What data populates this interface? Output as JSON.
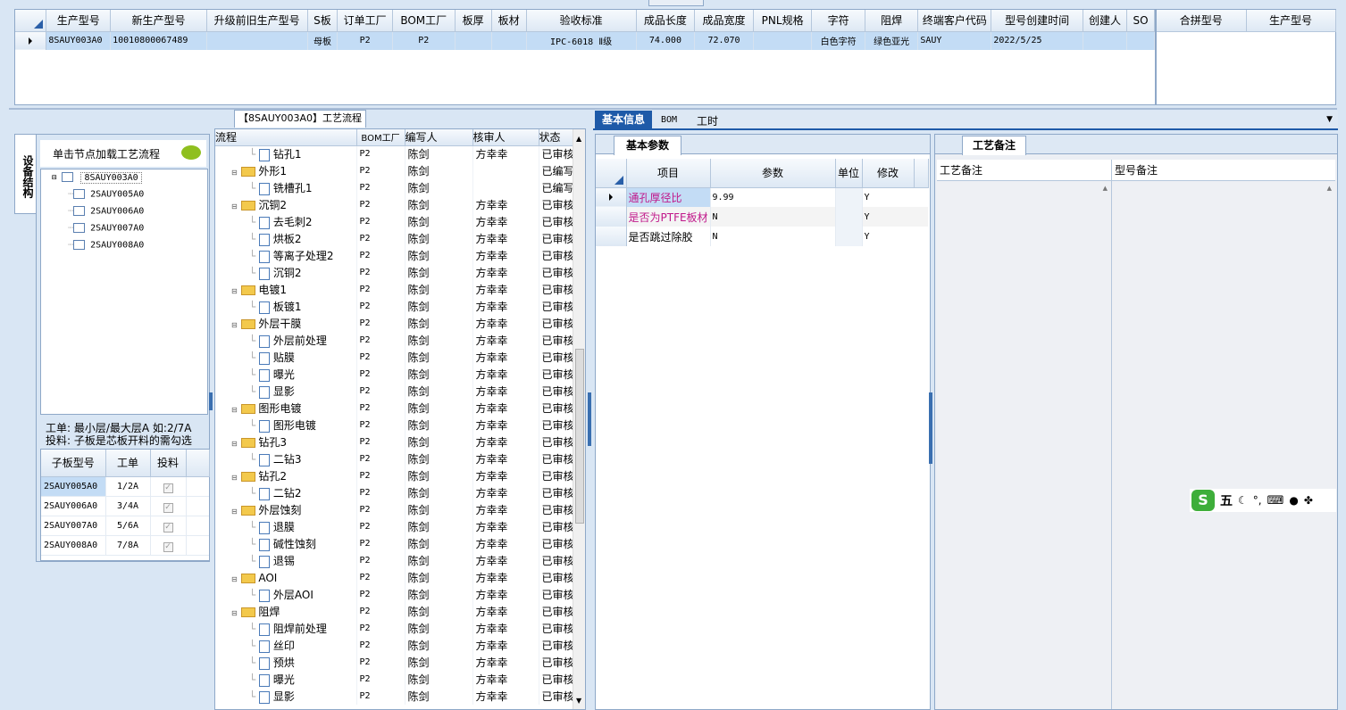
{
  "top_grid": {
    "columns": [
      "生产型号",
      "新生产型号",
      "升级前旧生产型号",
      "S板",
      "订单工厂",
      "BOM工厂",
      "板厚",
      "板材",
      "验收标准",
      "成品长度",
      "成品宽度",
      "PNL规格",
      "字符",
      "阻焊",
      "终端客户代码",
      "型号创建时间",
      "创建人",
      "SO"
    ],
    "row": [
      "8SAUY003A0",
      "10010800067489",
      "",
      "母板",
      "P2",
      "P2",
      "",
      "",
      "IPC-6018 Ⅱ级",
      "74.000",
      "72.070",
      "",
      "白色字符",
      "绿色亚光",
      "SAUY",
      "2022/5/25",
      "",
      ""
    ]
  },
  "merge_grid": {
    "columns": [
      "合拼型号",
      "生产型号"
    ]
  },
  "left_panel": {
    "side_tab": "设备结构",
    "hint": "单击节点加载工艺流程",
    "tree_root": "8SAUY003A0",
    "tree_children": [
      "2SAUY005A0",
      "2SAUY006A0",
      "2SAUY007A0",
      "2SAUY008A0"
    ],
    "note_line1": "工单: 最小层/最大层A 如:2/7A",
    "note_line2": "投料: 子板是芯板开料的需勾选",
    "sub_columns": [
      "子板型号",
      "工单",
      "投料"
    ],
    "sub_rows": [
      {
        "model": "2SAUY005A0",
        "order": "1/2A"
      },
      {
        "model": "2SAUY006A0",
        "order": "3/4A"
      },
      {
        "model": "2SAUY007A0",
        "order": "5/6A"
      },
      {
        "model": "2SAUY008A0",
        "order": "7/8A"
      }
    ]
  },
  "flow_panel": {
    "title": "【8SAUY003A0】工艺流程",
    "columns": [
      "流程",
      "BOM工厂",
      "编写人",
      "核审人",
      "状态"
    ],
    "rows": [
      {
        "name": "钻孔1",
        "lvl": 2,
        "f": "P2",
        "w": "陈剑",
        "r": "方幸幸",
        "s": "已审核"
      },
      {
        "name": "外形1",
        "lvl": 1,
        "f": "P2",
        "w": "陈剑",
        "r": "",
        "s": "已编写"
      },
      {
        "name": "铣槽孔1",
        "lvl": 2,
        "f": "P2",
        "w": "陈剑",
        "r": "",
        "s": "已编写"
      },
      {
        "name": "沉铜2",
        "lvl": 1,
        "f": "P2",
        "w": "陈剑",
        "r": "方幸幸",
        "s": "已审核"
      },
      {
        "name": "去毛刺2",
        "lvl": 2,
        "f": "P2",
        "w": "陈剑",
        "r": "方幸幸",
        "s": "已审核"
      },
      {
        "name": "烘板2",
        "lvl": 2,
        "f": "P2",
        "w": "陈剑",
        "r": "方幸幸",
        "s": "已审核"
      },
      {
        "name": "等离子处理2",
        "lvl": 2,
        "f": "P2",
        "w": "陈剑",
        "r": "方幸幸",
        "s": "已审核"
      },
      {
        "name": "沉铜2",
        "lvl": 2,
        "f": "P2",
        "w": "陈剑",
        "r": "方幸幸",
        "s": "已审核"
      },
      {
        "name": "电镀1",
        "lvl": 1,
        "f": "P2",
        "w": "陈剑",
        "r": "方幸幸",
        "s": "已审核"
      },
      {
        "name": "板镀1",
        "lvl": 2,
        "f": "P2",
        "w": "陈剑",
        "r": "方幸幸",
        "s": "已审核"
      },
      {
        "name": "外层干膜",
        "lvl": 1,
        "f": "P2",
        "w": "陈剑",
        "r": "方幸幸",
        "s": "已审核"
      },
      {
        "name": "外层前处理",
        "lvl": 2,
        "f": "P2",
        "w": "陈剑",
        "r": "方幸幸",
        "s": "已审核"
      },
      {
        "name": "贴膜",
        "lvl": 2,
        "f": "P2",
        "w": "陈剑",
        "r": "方幸幸",
        "s": "已审核"
      },
      {
        "name": "曝光",
        "lvl": 2,
        "f": "P2",
        "w": "陈剑",
        "r": "方幸幸",
        "s": "已审核"
      },
      {
        "name": "显影",
        "lvl": 2,
        "f": "P2",
        "w": "陈剑",
        "r": "方幸幸",
        "s": "已审核"
      },
      {
        "name": "图形电镀",
        "lvl": 1,
        "f": "P2",
        "w": "陈剑",
        "r": "方幸幸",
        "s": "已审核"
      },
      {
        "name": "图形电镀",
        "lvl": 2,
        "f": "P2",
        "w": "陈剑",
        "r": "方幸幸",
        "s": "已审核"
      },
      {
        "name": "钻孔3",
        "lvl": 1,
        "f": "P2",
        "w": "陈剑",
        "r": "方幸幸",
        "s": "已审核"
      },
      {
        "name": "二钻3",
        "lvl": 2,
        "f": "P2",
        "w": "陈剑",
        "r": "方幸幸",
        "s": "已审核"
      },
      {
        "name": "钻孔2",
        "lvl": 1,
        "f": "P2",
        "w": "陈剑",
        "r": "方幸幸",
        "s": "已审核"
      },
      {
        "name": "二钻2",
        "lvl": 2,
        "f": "P2",
        "w": "陈剑",
        "r": "方幸幸",
        "s": "已审核"
      },
      {
        "name": "外层蚀刻",
        "lvl": 1,
        "f": "P2",
        "w": "陈剑",
        "r": "方幸幸",
        "s": "已审核"
      },
      {
        "name": "退膜",
        "lvl": 2,
        "f": "P2",
        "w": "陈剑",
        "r": "方幸幸",
        "s": "已审核"
      },
      {
        "name": "碱性蚀刻",
        "lvl": 2,
        "f": "P2",
        "w": "陈剑",
        "r": "方幸幸",
        "s": "已审核"
      },
      {
        "name": "退锡",
        "lvl": 2,
        "f": "P2",
        "w": "陈剑",
        "r": "方幸幸",
        "s": "已审核"
      },
      {
        "name": "AOI",
        "lvl": 1,
        "f": "P2",
        "w": "陈剑",
        "r": "方幸幸",
        "s": "已审核"
      },
      {
        "name": "外层AOI",
        "lvl": 2,
        "f": "P2",
        "w": "陈剑",
        "r": "方幸幸",
        "s": "已审核"
      },
      {
        "name": "阻焊",
        "lvl": 1,
        "f": "P2",
        "w": "陈剑",
        "r": "方幸幸",
        "s": "已审核"
      },
      {
        "name": "阻焊前处理",
        "lvl": 2,
        "f": "P2",
        "w": "陈剑",
        "r": "方幸幸",
        "s": "已审核"
      },
      {
        "name": "丝印",
        "lvl": 2,
        "f": "P2",
        "w": "陈剑",
        "r": "方幸幸",
        "s": "已审核"
      },
      {
        "name": "预烘",
        "lvl": 2,
        "f": "P2",
        "w": "陈剑",
        "r": "方幸幸",
        "s": "已审核"
      },
      {
        "name": "曝光",
        "lvl": 2,
        "f": "P2",
        "w": "陈剑",
        "r": "方幸幸",
        "s": "已审核"
      },
      {
        "name": "显影",
        "lvl": 2,
        "f": "P2",
        "w": "陈剑",
        "r": "方幸幸",
        "s": "已审核"
      }
    ]
  },
  "right_panel": {
    "tabs": [
      "基本信息",
      "BOM",
      "工时"
    ],
    "params_tab": "基本参数",
    "param_columns": [
      "项目",
      "参数",
      "单位",
      "修改"
    ],
    "params": [
      {
        "item": "通孔厚径比",
        "value": "9.99",
        "unit": "",
        "edit": "Y",
        "pink": true
      },
      {
        "item": "是否为PTFE板材",
        "value": "N",
        "unit": "",
        "edit": "Y",
        "pink": true
      },
      {
        "item": "是否跳过除胶",
        "value": "N",
        "unit": "",
        "edit": "Y",
        "pink": false
      }
    ],
    "notes_tab": "工艺备注",
    "note_columns": [
      "工艺备注",
      "型号备注"
    ]
  },
  "ime": {
    "label": "五"
  },
  "colors": {
    "selected_row": "#c3dcf5",
    "tab_active": "#1e5aa8",
    "pink_text": "#c0178a",
    "panel_border": "#8ea8c8"
  }
}
